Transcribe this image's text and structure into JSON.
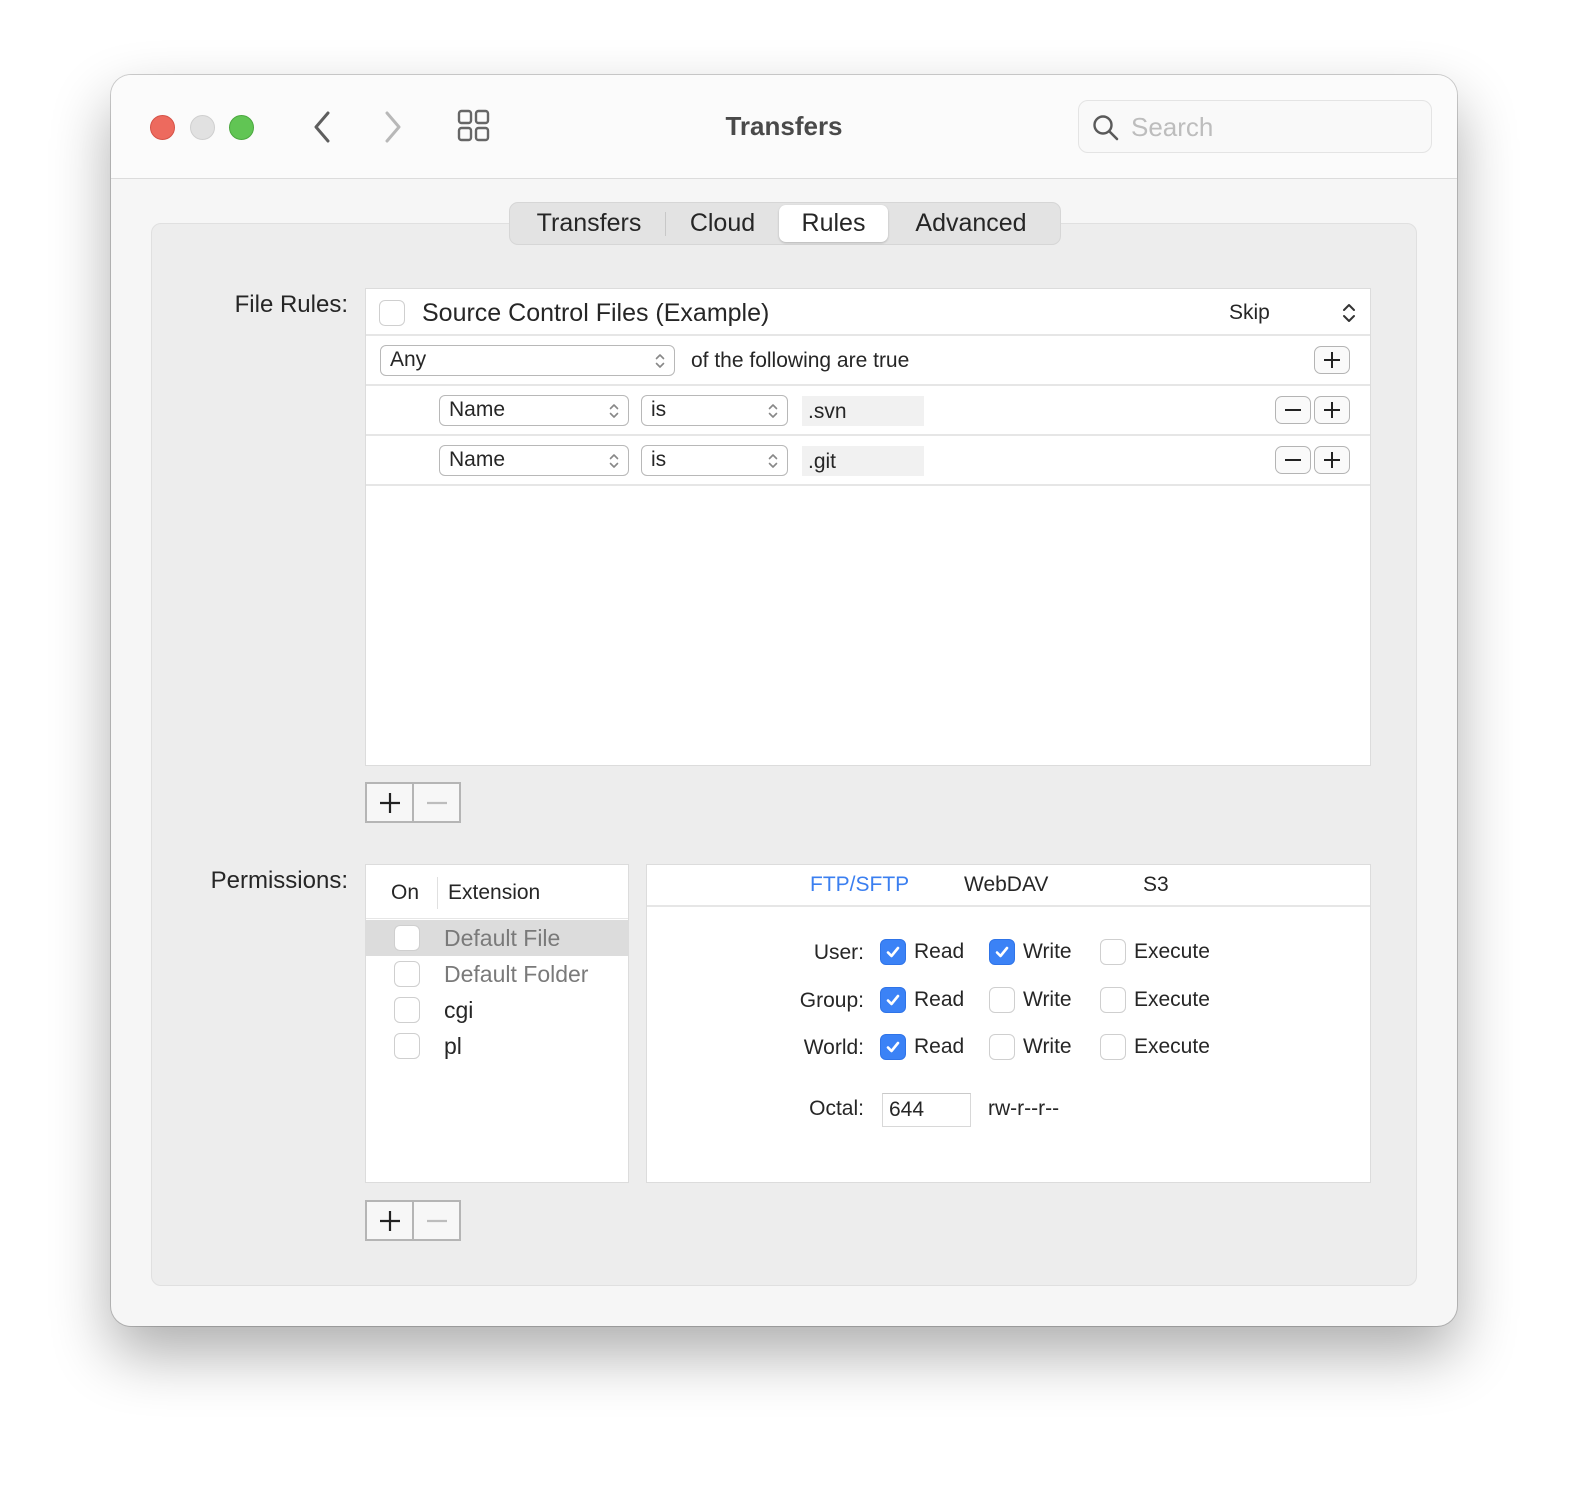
{
  "window": {
    "title": "Transfers",
    "search_placeholder": "Search",
    "search_value": ""
  },
  "tabs": [
    {
      "label": "Transfers",
      "active": false
    },
    {
      "label": "Cloud",
      "active": false
    },
    {
      "label": "Rules",
      "active": true
    },
    {
      "label": "Advanced",
      "active": false
    }
  ],
  "file_rules": {
    "label": "File Rules:",
    "rule": {
      "enabled": false,
      "name": "Source Control Files (Example)",
      "action": "Skip"
    },
    "match_mode": "Any",
    "match_suffix": "of the following are true",
    "conditions": [
      {
        "field": "Name",
        "operator": "is",
        "value": ".svn"
      },
      {
        "field": "Name",
        "operator": "is",
        "value": ".git"
      }
    ]
  },
  "permissions": {
    "label": "Permissions:",
    "columns": {
      "on": "On",
      "extension": "Extension"
    },
    "extensions": [
      {
        "name": "Default File",
        "enabled": false,
        "selected": true,
        "dimmed": true
      },
      {
        "name": "Default Folder",
        "enabled": false,
        "selected": false,
        "dimmed": true
      },
      {
        "name": "cgi",
        "enabled": false,
        "selected": false,
        "dimmed": false
      },
      {
        "name": "pl",
        "enabled": false,
        "selected": false,
        "dimmed": false
      }
    ],
    "protocol_tabs": [
      {
        "label": "FTP/SFTP",
        "active": true
      },
      {
        "label": "WebDAV",
        "active": false
      },
      {
        "label": "S3",
        "active": false
      }
    ],
    "rows": [
      {
        "label": "User:",
        "read": true,
        "write": true,
        "execute": false
      },
      {
        "label": "Group:",
        "read": true,
        "write": false,
        "execute": false
      },
      {
        "label": "World:",
        "read": true,
        "write": false,
        "execute": false
      }
    ],
    "check_labels": {
      "read": "Read",
      "write": "Write",
      "execute": "Execute"
    },
    "octal_label": "Octal:",
    "octal_value": "644",
    "symbolic": "rw-r--r--"
  },
  "colors": {
    "accent": "#3b82f6",
    "close": "#ed6a5e",
    "minimize": "#e1e1e1",
    "maximize": "#61c554"
  }
}
